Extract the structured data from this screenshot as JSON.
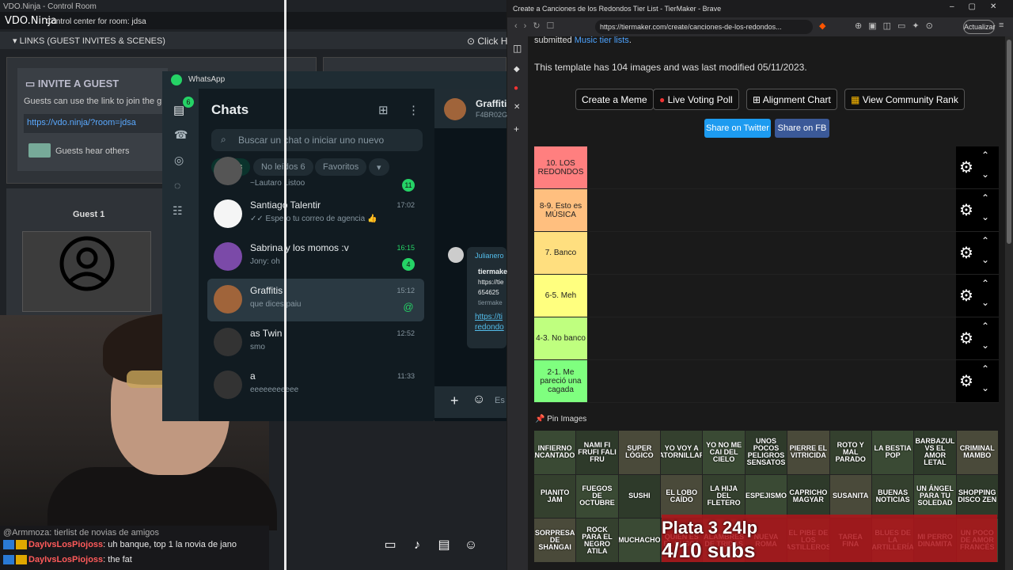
{
  "vdo": {
    "window_title": "VDO.Ninja - Control Room",
    "brand": "VDO.Ninja",
    "room_text": "Control center for room: jdsa",
    "links_header": "LINKS (GUEST INVITES & SCENES)",
    "click_here": "Click He",
    "invite_title": "INVITE A GUEST",
    "invite_desc": "Guests can use the link to join the gr",
    "invite_link": "https://vdo.ninja/?room=jdsa",
    "guests_hear": "Guests hear others",
    "guest_label": "Guest 1"
  },
  "stream_chat": [
    {
      "user": "@Armmoza",
      "text": ": tierlist de novias de amigos"
    },
    {
      "user": "DayIvsLosPiojoss",
      "text": ": uh banque, top 1 la novia de jano"
    },
    {
      "user": "DayIvsLosPiojoss",
      "text": ": the fat"
    }
  ],
  "whatsapp": {
    "window_title": "WhatsApp",
    "heading": "Chats",
    "search_placeholder": "Buscar un chat o iniciar uno nuevo",
    "filters": [
      "Todos",
      "No leídos 6",
      "Favoritos"
    ],
    "rail_badge": "6",
    "chats": [
      {
        "name": "",
        "msg": "~Lautaro Listoo",
        "time": "",
        "unread": "11",
        "color": "#555"
      },
      {
        "name": "Santiago Talentir",
        "msg": "✓✓ Espero tu correo de agencia 👍",
        "time": "17:02",
        "unread": "",
        "color": "#f5f5f5"
      },
      {
        "name": "Sabrina y los momos :v",
        "msg": "Jony: oh",
        "time": "16:15",
        "unread": "4",
        "color": "#7b4aa8"
      },
      {
        "name": "Graffitis",
        "msg": "que dices paiu",
        "time": "15:12",
        "unread": "@",
        "color": "#a0643a"
      },
      {
        "name": "as Twin",
        "msg": "smo",
        "time": "12:52",
        "unread": "",
        "color": "#333"
      },
      {
        "name": "a",
        "msg": "eeeeeeeeeee",
        "time": "11:33",
        "unread": "",
        "color": "#333"
      }
    ],
    "conv_name": "Graffitis",
    "conv_number": "F4BR02G",
    "bubble_sender": "Julianero",
    "bubble_lines": [
      "tiermake",
      "https://tie",
      "654625",
      "tiermake",
      "https://ti",
      "redondo"
    ],
    "input_placeholder": "Es"
  },
  "browser": {
    "window_title": "Create a Canciones de los Redondos Tier List - TierMaker - Brave",
    "url": "https://tiermaker.com/create/canciones-de-los-redondos...",
    "update_label": "Actualizar"
  },
  "tiermaker": {
    "submitted_prefix": "submitted ",
    "submitted_link": "Music tier lists",
    "info": "This template has 104 images and was last modified 05/11/2023.",
    "buttons": [
      "Create a Meme",
      "Live Voting Poll",
      "Alignment Chart",
      "View Community Rank"
    ],
    "share_twitter": "Share on Twitter",
    "share_fb": "Share on FB",
    "tiers": [
      {
        "label": "10. LOS REDONDOS",
        "color": "#ff7f7f"
      },
      {
        "label": "8-9. Esto es MÚSICA",
        "color": "#ffbf7f"
      },
      {
        "label": "7. Banco",
        "color": "#ffdf7f"
      },
      {
        "label": "6-5. Meh",
        "color": "#ffff7f"
      },
      {
        "label": "4-3. No banco",
        "color": "#bfff7f"
      },
      {
        "label": "2-1. Me pareció una cagada",
        "color": "#7fff7f"
      }
    ],
    "pin_label": "Pin Images",
    "pins": [
      "INFIERNO ENCANTADOR",
      "NAMI FI FRUFI FALI FRU",
      "SUPER LÓGICO",
      "YO VOY A ATORNILLAR",
      "YO NO ME CAI DEL CIELO",
      "UNOS POCOS PELIGROS SENSATOS",
      "PIERRE EL VITRICIDA",
      "ROTO Y MAL PARADO",
      "LA BESTIA POP",
      "BARBAZUL VS EL AMOR LETAL",
      "CRIMINAL MAMBO",
      "PIANITO JAM",
      "FUEGOS DE OCTUBRE",
      "SUSHI",
      "EL LOBO CAÍDO",
      "LA HIJA DEL FLETERO",
      "ESPEJISMO",
      "CAPRICHO MAGYAR",
      "SUSANITA",
      "BUENAS NOTICIAS",
      "UN ÁNGEL PARA TU SOLEDAD",
      "SHOPPING DISCO ZEN",
      "SORPRESA DE SHANGAI",
      "ROCK PARA EL NEGRO ATILA",
      "MUCHACHO",
      "QUIEN ES EL BUSCA",
      "ALAMBRES DE TRIDAS",
      "NUEVA ROMA",
      "EL PIBE DE LOS ASTILLEROS",
      "TAREA FINA",
      "BLUES DE LA ARTILLERÍA",
      "MI PERRO DINAMITA",
      "UN POCO DE AMOR FRANCÉS"
    ],
    "overlay_line1": "Plata 3 24lp",
    "overlay_line2": "4/10 subs"
  }
}
